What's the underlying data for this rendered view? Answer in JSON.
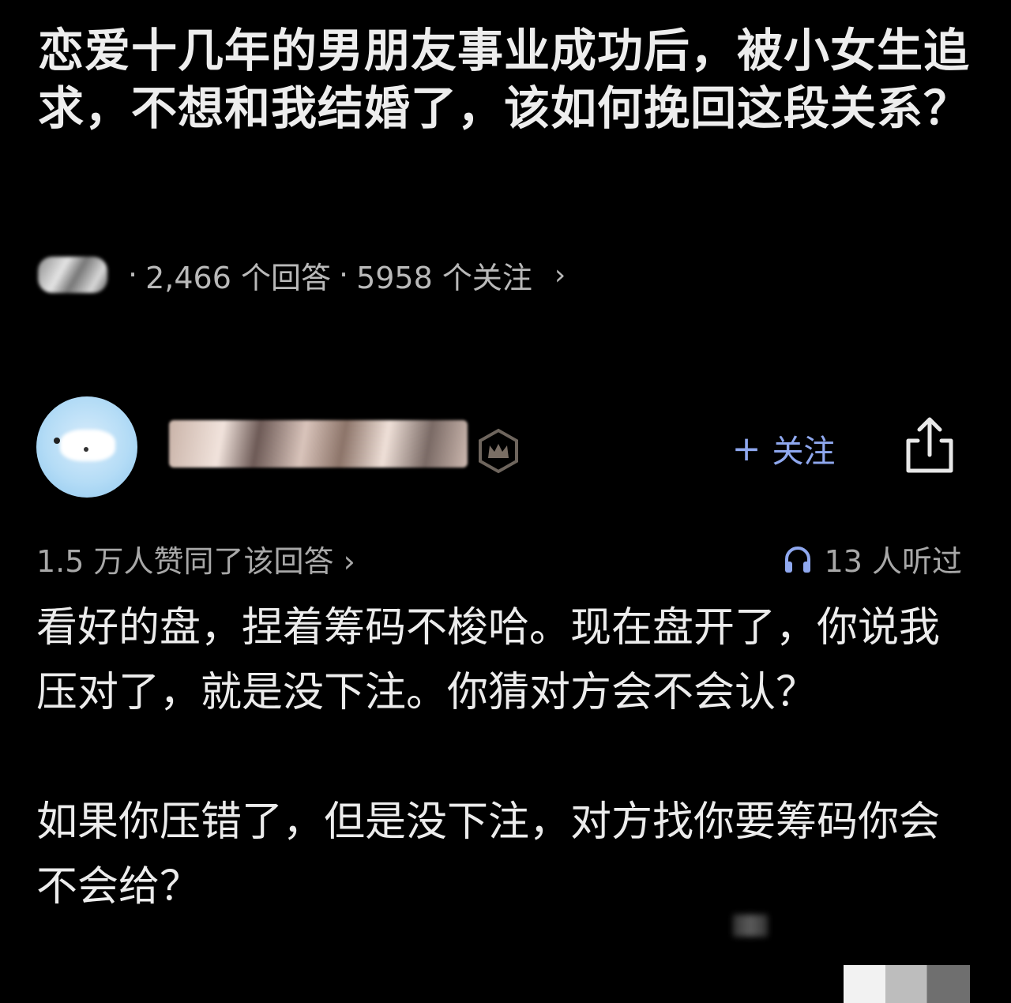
{
  "question": {
    "title": "恋爱十几年的男朋友事业成功后，被小女生追求，不想和我结婚了，该如何挽回这段关系？",
    "answer_count": "2,466 个回答",
    "follower_count": "5958 个关注",
    "separator": "·",
    "chevron": "›"
  },
  "answer": {
    "follow_label": "关注",
    "follow_plus": "+",
    "upvote_text": "1.5 万人赞同了该回答 ›",
    "listen_text": "13 人听过",
    "paragraphs": [
      "看好的盘，捏着筹码不梭哈。现在盘开了，你说我压对了，就是没下注。你猜对方会不会认？",
      "如果你压错了，但是没下注，对方找你要筹码你会不会给？"
    ]
  },
  "colors": {
    "background": "#000000",
    "accent": "#8fa8ef",
    "text": "#ececec",
    "muted": "#a8a8a8"
  },
  "icons": [
    "crown-badge-icon",
    "share-icon",
    "headphones-icon",
    "chevron-right-icon",
    "plus-icon"
  ]
}
